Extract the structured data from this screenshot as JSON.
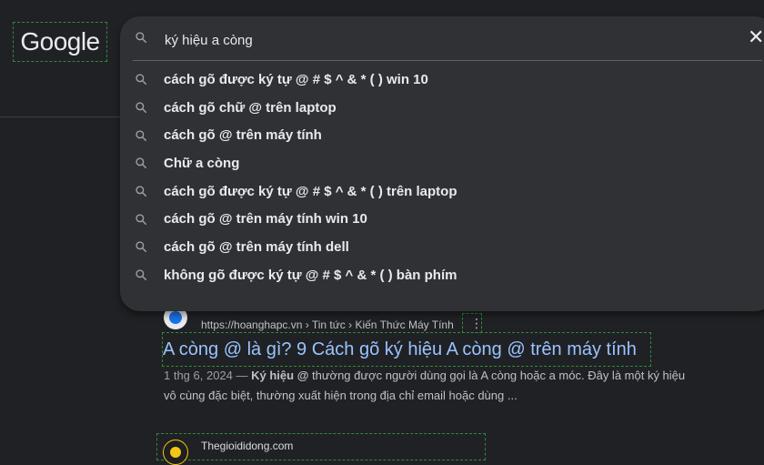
{
  "logo": "Google",
  "search": {
    "query": "ký hiệu a còng",
    "clear_symbol": "✕"
  },
  "suggestions": [
    "cách gõ được ký tự @ # $ ^ & * ( ) win 10",
    "cách gõ chữ @ trên laptop",
    "cách gõ @ trên máy tính",
    "Chữ a còng",
    "cách gõ được ký tự @ # $ ^ & * ( ) trên laptop",
    "cách gõ @ trên máy tính win 10",
    "cách gõ @ trên máy tính dell",
    "không gõ được ký tự @ # $ ^ & * ( ) bàn phím"
  ],
  "results": [
    {
      "breadcrumb": "https://hoanghapc.vn › Tin tức › Kiến Thức Máy Tính",
      "more": "⋮",
      "title": "A còng @ là gì? 9 Cách gõ ký hiệu A còng @ trên máy tính",
      "date": "1 thg 6, 2024 —",
      "snippet_bold": "Ký hiệu @",
      "snippet_rest_1": " thường được người dùng gọi là A còng hoặc a móc. Đây là một ký hiệu",
      "snippet_line2": "vô cùng đặc biệt, thường xuất hiện trong địa chỉ email hoặc dùng ..."
    },
    {
      "site": "Thegioididong.com"
    }
  ],
  "colors": {
    "background": "#202124",
    "panel": "#303134",
    "link": "#99c3ff"
  }
}
